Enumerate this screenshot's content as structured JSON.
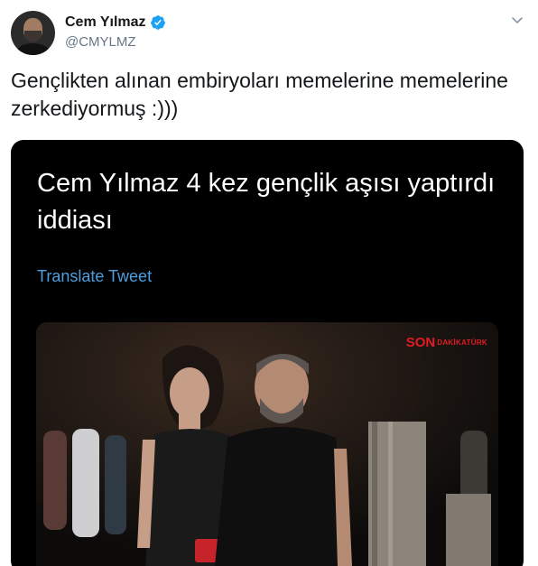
{
  "author": {
    "display_name": "Cem Yılmaz",
    "handle": "@CMYLMZ"
  },
  "tweet": {
    "text": "Gençlikten alınan embiryoları memelerine memelerine zerkediyormuş :)))"
  },
  "quoted": {
    "text": "Cem Yılmaz 4 kez gençlik aşısı yaptırdı iddiası",
    "translate_label": "Translate Tweet"
  },
  "photo": {
    "watermark_main": "SON",
    "watermark_sub": "DAKİKATÜRK"
  },
  "colors": {
    "verified": "#1da1f2",
    "link": "#4d9fe0",
    "watermark": "#e31b23"
  },
  "icons": [
    "verified-badge-icon",
    "chevron-down-icon"
  ]
}
